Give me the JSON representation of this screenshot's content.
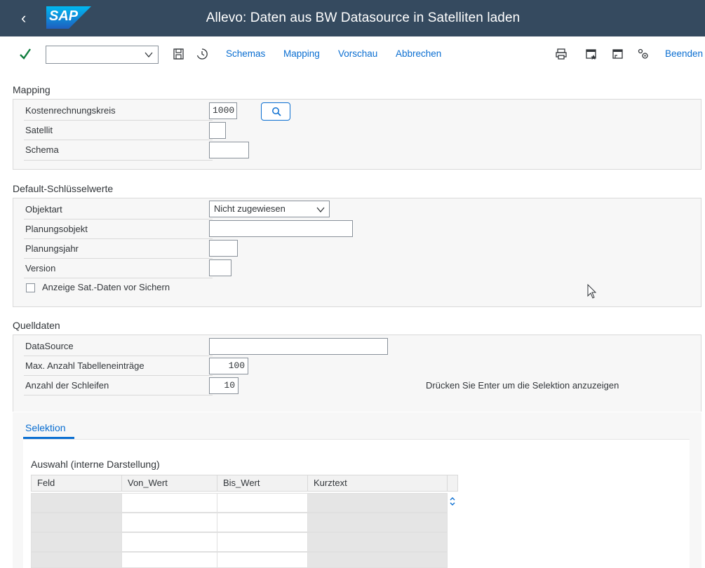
{
  "shell": {
    "back_glyph": "‹",
    "logo_text": "SAP",
    "title": "Allevo: Daten aus BW Datasource in Satelliten laden",
    "bg_color": "#354a5f"
  },
  "toolbar": {
    "command_field_value": "",
    "buttons": [
      "Schemas",
      "Mapping",
      "Vorschau",
      "Abbrechen"
    ],
    "exit_label": "Beenden",
    "icons": [
      "checkmark-icon",
      "save-icon",
      "history-icon",
      "print-icon",
      "new-session-icon",
      "window-icon",
      "settings-icon"
    ],
    "accent_color": "#0a6ed1"
  },
  "mapping": {
    "title": "Mapping",
    "fields": [
      {
        "label": "Kostenrechnungskreis",
        "value": "1000"
      },
      {
        "label": "Satellit",
        "value": ""
      },
      {
        "label": "Schema",
        "value": ""
      }
    ]
  },
  "defaults": {
    "title": "Default-Schlüsselwerte",
    "fields": [
      {
        "label": "Objektart",
        "value": "Nicht zugewiesen"
      },
      {
        "label": "Planungsobjekt",
        "value": ""
      },
      {
        "label": "Planungsjahr",
        "value": ""
      },
      {
        "label": "Version",
        "value": ""
      }
    ],
    "checkbox_label": "Anzeige Sat.-Daten vor Sichern",
    "checkbox_checked": false
  },
  "source": {
    "title": "Quelldaten",
    "fields": [
      {
        "label": "DataSource",
        "value": ""
      },
      {
        "label": "Max. Anzahl Tabelleneinträge",
        "value": "100"
      },
      {
        "label": "Anzahl der Schleifen",
        "value": "10"
      }
    ],
    "hint": "Drücken Sie Enter um die Selektion anzuzeigen"
  },
  "selection": {
    "tab_label": "Selektion",
    "table_title": "Auswahl (interne Darstellung)",
    "columns": [
      "Feld",
      "Von_Wert",
      "Bis_Wert",
      "Kurztext"
    ],
    "rows": [
      [
        "",
        "",
        "",
        ""
      ],
      [
        "",
        "",
        "",
        ""
      ],
      [
        "",
        "",
        "",
        ""
      ],
      [
        "",
        "",
        "",
        ""
      ]
    ]
  }
}
